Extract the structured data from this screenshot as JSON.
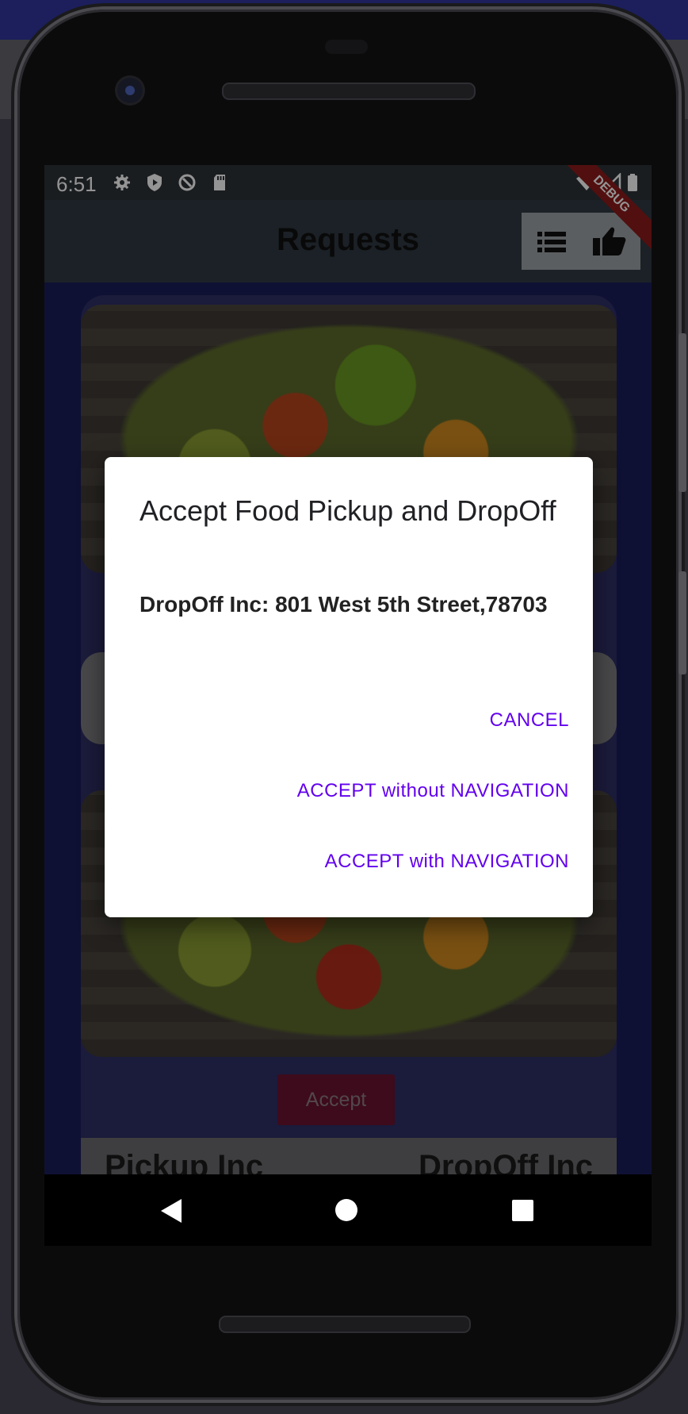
{
  "status_bar": {
    "time": "6:51",
    "left_icons": [
      "gear-icon",
      "play-shield-icon",
      "at-sign-icon",
      "sd-card-icon"
    ],
    "right_icons": [
      "wifi-icon",
      "cell-signal-icon",
      "battery-icon"
    ],
    "debug_banner": "DEBUG"
  },
  "app_bar": {
    "title": "Requests",
    "actions": [
      "list-icon",
      "thumb-up-icon"
    ]
  },
  "cards": [
    {
      "favorite_icon": "heart-outline-icon"
    },
    {
      "accept_label": "Accept",
      "pickup_label": "Pickup Inc",
      "dropoff_label": "DropOff Inc"
    }
  ],
  "dialog": {
    "title": "Accept Food Pickup and DropOff",
    "message": "DropOff Inc: 801 West 5th Street,78703",
    "actions": {
      "cancel": "CANCEL",
      "accept_without_nav": "ACCEPT without NAVIGATION",
      "accept_with_nav": "ACCEPT with NAVIGATION"
    }
  },
  "nav_bar": {
    "icons": [
      "back-icon",
      "home-icon",
      "recents-icon"
    ]
  },
  "colors": {
    "dialog_button": "#6200ee",
    "accept_button": "#c2185b",
    "app_bar": "#4a5a66",
    "body_background": "#3036a8"
  }
}
